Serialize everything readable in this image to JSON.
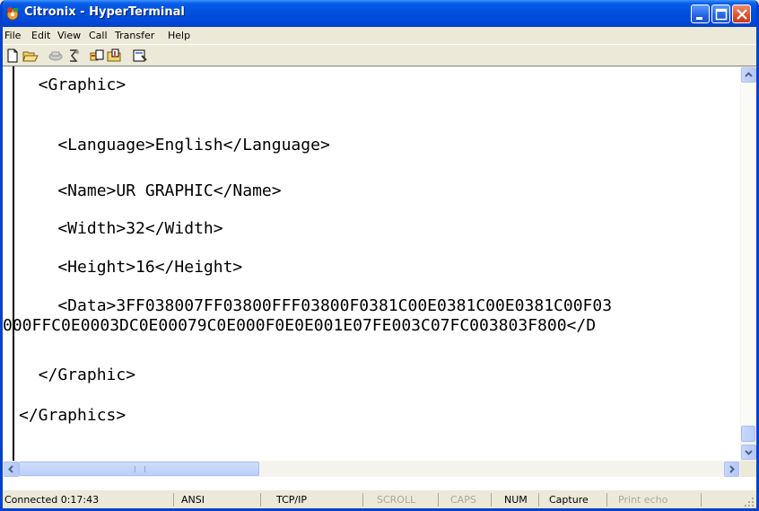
{
  "window": {
    "title": "Citronix - HyperTerminal"
  },
  "menu": [
    "File",
    "Edit",
    "View",
    "Call",
    "Transfer",
    "Help"
  ],
  "toolbar": {
    "icons": [
      "new-icon",
      "open-icon",
      "connect-icon",
      "disconnect-icon",
      "send-icon",
      "receive-icon",
      "properties-icon"
    ]
  },
  "terminal": {
    "lines": [
      "  <Graphic>",
      "    <Language>English</Language>",
      "    <Name>UR GRAPHIC</Name>",
      "    <Width>32</Width>",
      "    <Height>16</Height>",
      "    <Data>3FF038007FF03800FFF03800F0381C00E0381C00E0381C00F03",
      "000FFC0E0003DC0E00079C0E000F0E0E001E07FE003C07FC003803F800</D",
      "  </Graphic>",
      "</Graphics>"
    ]
  },
  "statusbar": {
    "connected": "Connected 0:17:43",
    "emulation": "ANSI",
    "protocol": "TCP/IP",
    "scroll": "SCROLL",
    "caps": "CAPS",
    "num": "NUM",
    "capture": "Capture",
    "print_echo": "Print echo"
  },
  "colors": {
    "titlebar": "#0052E0",
    "window_border": "#0842C8",
    "chrome": "#ECE9D8",
    "close_button": "#E0502B"
  }
}
